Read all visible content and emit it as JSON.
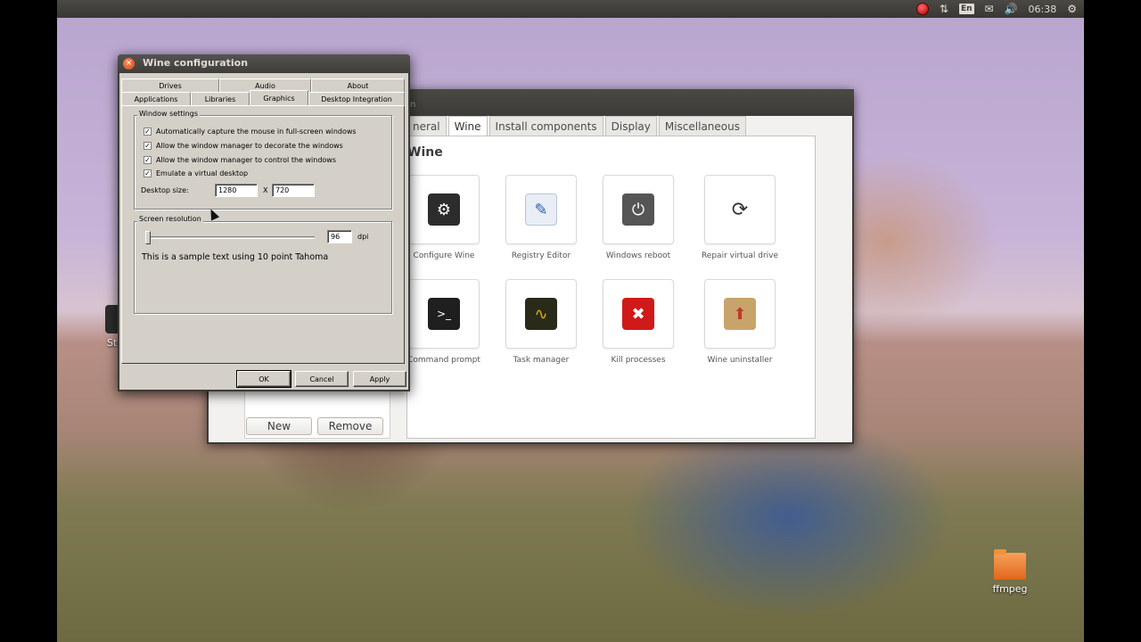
{
  "top_panel": {
    "keyboard_layout": "En",
    "clock": "06:38"
  },
  "desktop": {
    "icons": [
      {
        "label": "Ste"
      },
      {
        "label": "ffmpeg"
      }
    ]
  },
  "back_window": {
    "title_partial": "n",
    "tabs": [
      "neral",
      "Wine",
      "Install components",
      "Display",
      "Miscellaneous"
    ],
    "active_tab": "Wine",
    "section_title": "Wine",
    "tools": [
      {
        "label": "Configure Wine",
        "icon": "gear-icon"
      },
      {
        "label": "Registry Editor",
        "icon": "registry-icon"
      },
      {
        "label": "Windows reboot",
        "icon": "power-icon"
      },
      {
        "label": "Repair virtual drive",
        "icon": "repair-icon"
      },
      {
        "label": "Command prompt",
        "icon": "terminal-icon"
      },
      {
        "label": "Task manager",
        "icon": "task-manager-icon"
      },
      {
        "label": "Kill processes",
        "icon": "kill-icon"
      },
      {
        "label": "Wine uninstaller",
        "icon": "uninstaller-icon"
      }
    ],
    "buttons": {
      "new": "New",
      "remove": "Remove"
    }
  },
  "wine_config": {
    "title": "Wine configuration",
    "tabs_row1": [
      "Drives",
      "Audio",
      "About"
    ],
    "tabs_row2": [
      "Applications",
      "Libraries",
      "Graphics",
      "Desktop Integration"
    ],
    "active_tab": "Graphics",
    "window_settings": {
      "legend": "Window settings",
      "options": [
        {
          "label": "Automatically capture the mouse in full-screen windows",
          "checked": true
        },
        {
          "label": "Allow the window manager to decorate the windows",
          "checked": true
        },
        {
          "label": "Allow the window manager to control the windows",
          "checked": true
        },
        {
          "label": "Emulate a virtual desktop",
          "checked": true
        }
      ],
      "desktop_size_label": "Desktop size:",
      "width": "1280",
      "x_label": "X",
      "height": "720"
    },
    "screen_resolution": {
      "legend": "Screen resolution",
      "dpi_value": "96",
      "dpi_label": "dpi",
      "sample_text": "This is a sample text using 10 point Tahoma"
    },
    "buttons": {
      "ok": "OK",
      "cancel": "Cancel",
      "apply": "Apply"
    }
  }
}
